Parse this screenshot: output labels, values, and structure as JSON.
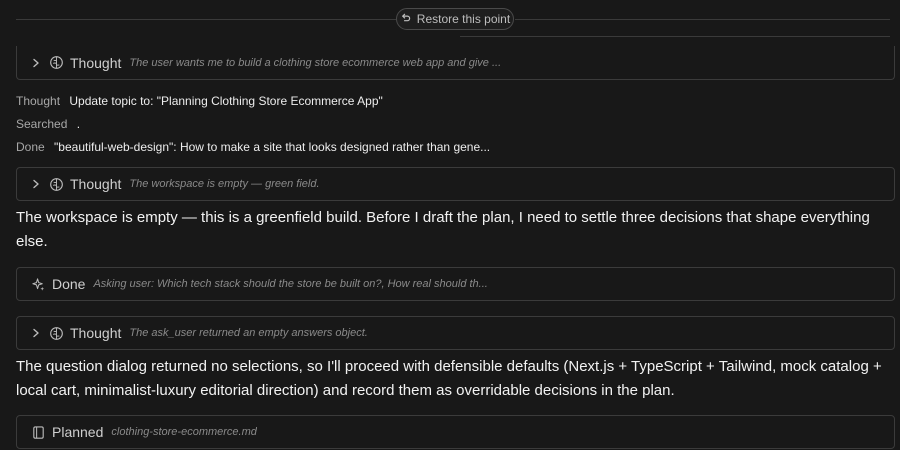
{
  "restore": {
    "label": "Restore this point",
    "icon": "restore-icon"
  },
  "thought1": {
    "title": "Thought",
    "summary": "The user wants me to build a clothing store ecommerce web app and give ..."
  },
  "activity": [
    {
      "label": "Thought",
      "value": "Update topic to: \"Planning Clothing Store Ecommerce App\""
    },
    {
      "label": "Searched",
      "value": "."
    },
    {
      "label": "Done",
      "value": "\"beautiful-web-design\": How to make a site that looks designed rather than gene..."
    }
  ],
  "thought2": {
    "title": "Thought",
    "summary": "The workspace is empty — green field."
  },
  "message1": "The workspace is empty — this is a greenfield build. Before I draft the plan, I need to settle three decisions that shape everything else.",
  "done_card": {
    "title": "Done",
    "summary": "Asking user: Which tech stack should the store be built on?, How real should th..."
  },
  "thought3": {
    "title": "Thought",
    "summary": "The ask_user returned an empty answers object."
  },
  "message2": "The question dialog returned no selections, so I'll proceed with defensible defaults (Next.js + TypeScript + Tailwind, mock catalog + local cart, minimalist-luxury editorial direction) and record them as overridable decisions in the plan.",
  "planned": {
    "title": "Planned",
    "file": "clothing-store-ecommerce.md"
  }
}
